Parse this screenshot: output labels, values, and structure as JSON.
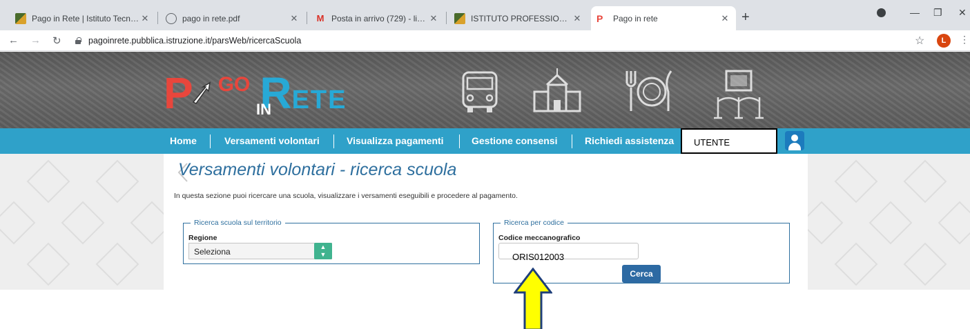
{
  "browser": {
    "tabs": [
      {
        "title": "Pago in Rete | Istituto Tecnico Eco",
        "icon": "pagoinrete-favicon"
      },
      {
        "title": "pago in rete.pdf",
        "icon": "globe-icon"
      },
      {
        "title": "Posta in arrivo (729) - lisabolcati",
        "icon": "gmail-icon"
      },
      {
        "title": "ISTITUTO PROFESSIONALE STATA",
        "icon": "pagoinrete-favicon"
      },
      {
        "title": "Pago in rete",
        "icon": "pagoinrete-favicon",
        "active": true
      }
    ],
    "url": "pagoinrete.pubblica.istruzione.it/parsWeb/ricercaScuola",
    "profile_initial": "L"
  },
  "header": {
    "logo": {
      "p": "P",
      "go": "GO",
      "in": "IN",
      "r": "R",
      "ete": "ETE"
    }
  },
  "nav": {
    "items": [
      "Home",
      "Versamenti volontari",
      "Visualizza pagamenti",
      "Gestione consensi",
      "Richiedi assistenza"
    ],
    "user_label": "UTENTE"
  },
  "main": {
    "title": "Versamenti volontari - ricerca scuola",
    "description": "In questa sezione puoi ricercare una scuola, visualizzare i versamenti eseguibili e procedere al pagamento.",
    "territorio": {
      "legend": "Ricerca scuola sul territorio",
      "region_label": "Regione",
      "region_value": "Seleziona"
    },
    "codice": {
      "legend": "Ricerca per codice",
      "code_label": "Codice meccanografico",
      "code_value": "ORIS012003",
      "search_button": "Cerca"
    }
  },
  "colors": {
    "nav_bar": "#2fa1c9",
    "title_blue": "#2e6f9e",
    "button": "#2d6aa3",
    "select_arrow": "#40b38f",
    "arrow_fill": "#ffff00",
    "arrow_stroke": "#1f3f7a"
  }
}
